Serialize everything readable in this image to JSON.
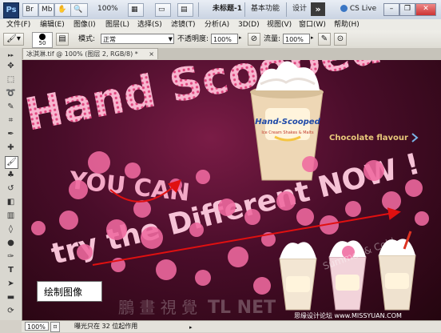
{
  "titlebar": {
    "logo": "Ps",
    "zoom": "100%",
    "doc_title": "未标题-1",
    "workspace_basic": "基本功能",
    "workspace_design": "设计",
    "more": "»",
    "cslive": "CS Live"
  },
  "menu": [
    "文件(F)",
    "编辑(E)",
    "图像(I)",
    "图层(L)",
    "选择(S)",
    "滤镜(T)",
    "分析(A)",
    "3D(D)",
    "视图(V)",
    "窗口(W)",
    "帮助(H)"
  ],
  "options": {
    "brush_size": "50",
    "mode_label": "模式:",
    "mode_value": "正常",
    "opacity_label": "不透明度:",
    "opacity_value": "100%",
    "flow_label": "流量:",
    "flow_value": "100%"
  },
  "document": {
    "tab_label": "冰淇淋.tif @ 100% (图层 2, RGB/8) *",
    "close": "×"
  },
  "artwork": {
    "headline": "Hand Scooped",
    "line2": "YOU CAN",
    "line3": "try the Different NOW !",
    "flavour": "Chocolate flavour",
    "brand": "Hand-Scooped",
    "brand_sub": "Ice Cream Shakes & Malts",
    "watermark": "TL NET",
    "watermark_cn": "鵬 畫 視 覺",
    "watermark_right": "Summer & Cold",
    "footer_credit": "思缘设计论坛 www.MISSYUAN.COM"
  },
  "caption": "绘制图像",
  "status": {
    "zoom": "100%",
    "info": "曝光只在 32 位起作用"
  },
  "colors": {
    "pink": "#f06aa0",
    "background": "#4a0d2a",
    "arrow": "#e01010"
  }
}
